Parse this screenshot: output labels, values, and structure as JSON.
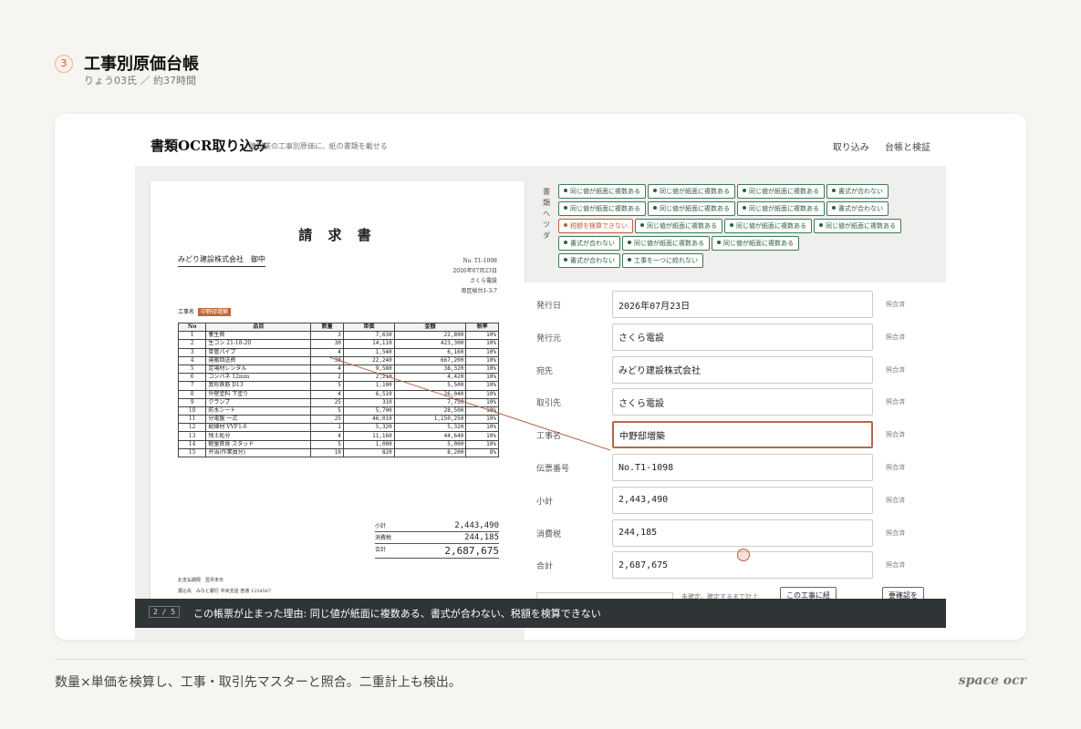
{
  "slide": {
    "step": "3",
    "title": "工事別原価台帳",
    "subtitle": "りょう03氏 ／ 約37時間"
  },
  "app": {
    "title": "書類OCR取り込み",
    "subtitle": "建設業の工事別原価に、紙の書類を載せる",
    "nav": [
      "取り込み",
      "台帳と検証"
    ]
  },
  "document": {
    "title": "請 求 書",
    "addressee": "みどり建設株式会社　御中",
    "number": "No. T1-1098",
    "date": "2026年07月23日",
    "issuer": "さくら電設",
    "issuer_address": "南区桜台1-3-7",
    "project_label": "工事名",
    "project_value": "中野邸増築",
    "columns": [
      "No",
      "品目",
      "数量",
      "単価",
      "金額",
      "税率"
    ],
    "rows": [
      [
        "1",
        "養生費",
        "3",
        "7,630",
        "22,890",
        "10%"
      ],
      [
        "2",
        "生コン 21-18-20",
        "30",
        "14,110",
        "423,300",
        "10%"
      ],
      [
        "3",
        "単管パイプ",
        "4",
        "1,540",
        "6,160",
        "10%"
      ],
      [
        "4",
        "運搬回送費",
        "30",
        "22,240",
        "667,200",
        "10%"
      ],
      [
        "5",
        "足場材レンタル",
        "4",
        "9,580",
        "38,320",
        "10%"
      ],
      [
        "6",
        "コンパネ 12mm",
        "2",
        "2,210",
        "4,420",
        "10%"
      ],
      [
        "7",
        "異形鉄筋 D13",
        "5",
        "1,100",
        "5,500",
        "10%"
      ],
      [
        "8",
        "外壁塗料 下塗り",
        "4",
        "6,510",
        "26,040",
        "10%"
      ],
      [
        "9",
        "クランプ",
        "25",
        "310",
        "7,750",
        "10%"
      ],
      [
        "10",
        "防水シート",
        "5",
        "5,700",
        "28,500",
        "10%"
      ],
      [
        "11",
        "分電盤 一式",
        "25",
        "46,010",
        "1,150,250",
        "10%"
      ],
      [
        "12",
        "配線材 VVF1.6",
        "1",
        "5,320",
        "5,320",
        "10%"
      ],
      [
        "13",
        "残土処分",
        "4",
        "11,160",
        "44,640",
        "10%"
      ],
      [
        "14",
        "軽量鉄骨 スタッド",
        "5",
        "1,000",
        "5,000",
        "10%"
      ],
      [
        "15",
        "弁当(作業員分)",
        "10",
        "820",
        "8,200",
        "8%"
      ]
    ],
    "subtotal_label": "小計",
    "subtotal": "2,443,490",
    "tax_label": "消費税",
    "tax": "244,185",
    "total_label": "合計",
    "total": "2,687,675",
    "payment_due_label": "お支払期限",
    "payment_due": "翌月末日",
    "bank_label": "振込先",
    "bank": "みなと銀行 中央支店 普通 1234567"
  },
  "tag_panel": {
    "label": "書類へツダ",
    "rows": [
      [
        "同じ値が紙面に複数ある",
        "同じ値が紙面に複数ある",
        "同じ値が紙面に複数ある",
        "書式が合わない"
      ],
      [
        "同じ値が紙面に複数ある",
        "同じ値が紙面に複数ある",
        "同じ値が紙面に複数ある",
        "書式が合わない"
      ],
      [
        "税額を検算できない",
        "同じ値が紙面に複数ある",
        "同じ値が紙面に複数ある",
        "同じ値が紙面に複数ある"
      ],
      [
        "書式が合わない",
        "同じ値が紙面に複数ある",
        "同じ値が紙面に複数ある"
      ],
      [
        "書式が合わない",
        "工事を一つに絞れない"
      ]
    ]
  },
  "form": {
    "fields": [
      {
        "label": "発行日",
        "value": "2026年07月23日",
        "status": "照合済"
      },
      {
        "label": "発行元",
        "value": "さくら電設",
        "status": "照合済"
      },
      {
        "label": "宛先",
        "value": "みどり建設株式会社",
        "status": "照合済"
      },
      {
        "label": "取引先",
        "value": "さくら電設",
        "status": "照合済"
      },
      {
        "label": "工事名",
        "value": "中野邸増築",
        "status": "照合済"
      },
      {
        "label": "伝票番号",
        "value": "No.T1-1098",
        "status": "照合済"
      },
      {
        "label": "小計",
        "value": "2,443,490",
        "status": "照合済"
      },
      {
        "label": "消費税",
        "value": "244,185",
        "status": "照合済"
      },
      {
        "label": "合計",
        "value": "2,687,675",
        "status": "照合済"
      }
    ],
    "undecided_note": "未確定。確定するまで計上",
    "assign_button": "この工事に紐",
    "review_button": "要確認を"
  },
  "status_bar": {
    "counter": "2 / 5",
    "message": "この帳票が止まった理由: 同じ値が紙面に複数ある、書式が合わない、税額を検算できない"
  },
  "footer": {
    "caption": "数量×単価を検算し、工事・取引先マスターと照合。二重計上も検出。",
    "brand": "space ocr"
  },
  "colors": {
    "accent": "#c45a3e",
    "tag_ok": "#3f7a5a",
    "status_bar": "#2f3437"
  }
}
